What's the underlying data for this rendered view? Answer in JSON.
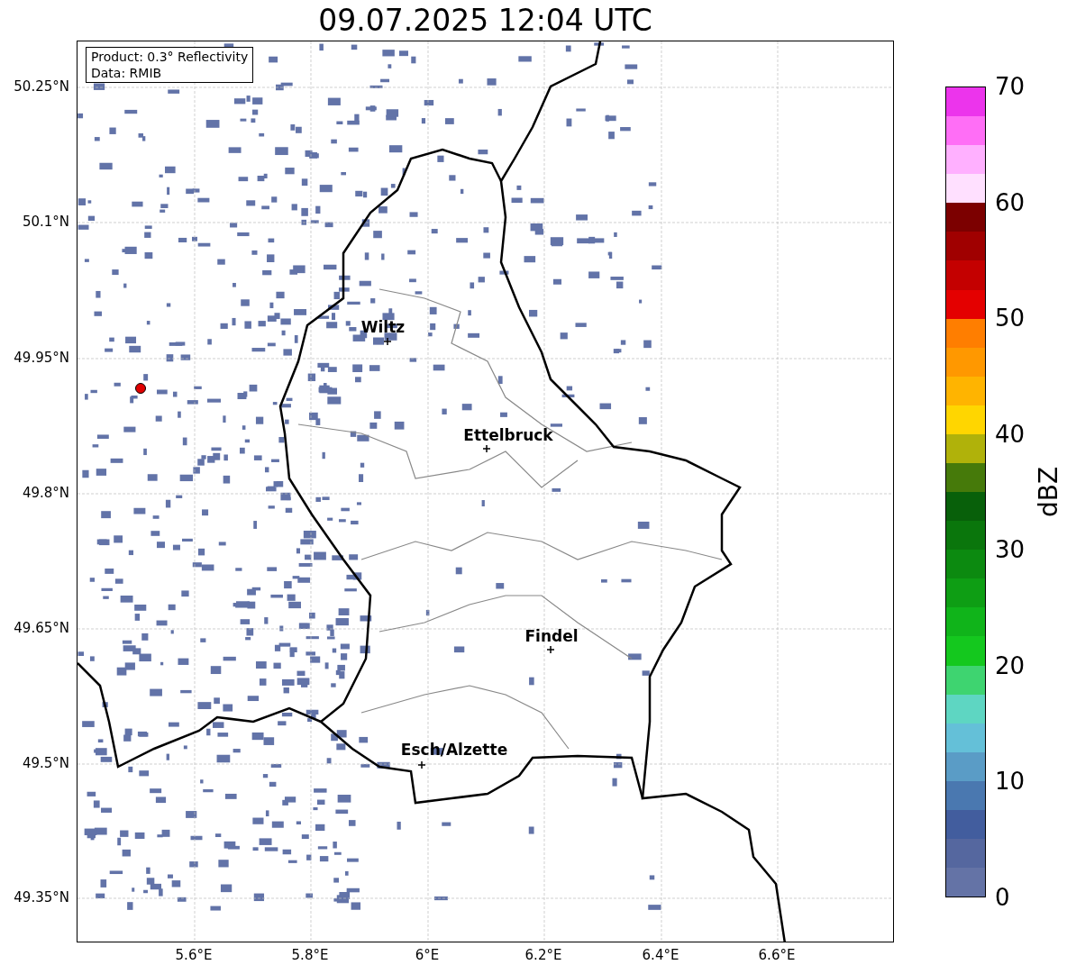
{
  "title": "09.07.2025 12:04 UTC",
  "map": {
    "legend": [
      "Product: 0.3° Reflectivity",
      "Data: RMIB"
    ],
    "places": [
      {
        "name": "Wiltz"
      },
      {
        "name": "Ettelbruck"
      },
      {
        "name": "Findel"
      },
      {
        "name": "Esch/Alzette"
      }
    ],
    "yticks": [
      "50.25°N",
      "50.1°N",
      "49.95°N",
      "49.8°N",
      "49.65°N",
      "49.5°N",
      "49.35°N"
    ],
    "xticks": [
      "5.6°E",
      "5.8°E",
      "6°E",
      "6.2°E",
      "6.4°E",
      "6.6°E"
    ]
  },
  "colorbar": {
    "label": "dBZ",
    "ticks": [
      "70",
      "60",
      "50",
      "40",
      "30",
      "20",
      "10",
      "0"
    ],
    "bands": [
      {
        "color": "#ec34ec"
      },
      {
        "color": "#ff6ef6"
      },
      {
        "color": "#ffb0ff"
      },
      {
        "color": "#ffe0ff"
      },
      {
        "color": "#7c0000"
      },
      {
        "color": "#a00000"
      },
      {
        "color": "#c40000"
      },
      {
        "color": "#e40000"
      },
      {
        "color": "#ff7e00"
      },
      {
        "color": "#ff9800"
      },
      {
        "color": "#ffb400"
      },
      {
        "color": "#ffd600"
      },
      {
        "color": "#b0b20a"
      },
      {
        "color": "#467a0a"
      },
      {
        "color": "#08600a"
      },
      {
        "color": "#0a760c"
      },
      {
        "color": "#0c8a10"
      },
      {
        "color": "#0e9e14"
      },
      {
        "color": "#10b41a"
      },
      {
        "color": "#14c81e"
      },
      {
        "color": "#3ed470"
      },
      {
        "color": "#5ed6c2"
      },
      {
        "color": "#64c0d8"
      },
      {
        "color": "#5a9cc6"
      },
      {
        "color": "#4a78b0"
      },
      {
        "color": "#425d9e"
      },
      {
        "color": "#55679f"
      },
      {
        "color": "#6473a6"
      }
    ]
  }
}
